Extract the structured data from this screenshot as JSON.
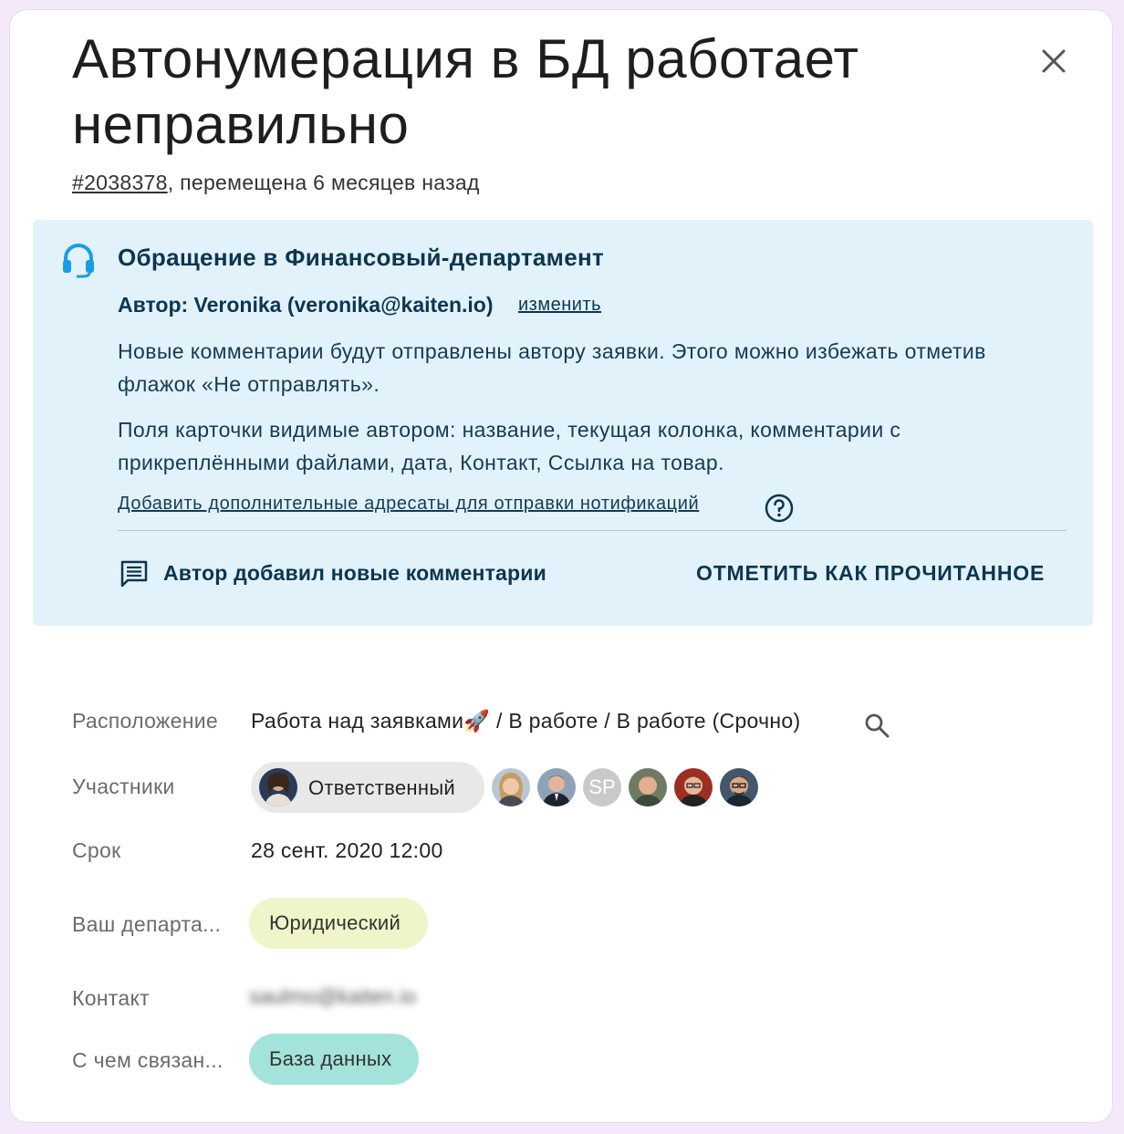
{
  "header": {
    "title": "Автонумерация в БД работает неправильно",
    "id_link": "#2038378",
    "moved_text": ", перемещена 6 месяцев назад",
    "close_icon": "close-icon"
  },
  "service_desk": {
    "icon": "headset-icon",
    "title": "Обращение в Финансовый-департамент",
    "author": "Автор: Veronika (veronika@kaiten.io)",
    "change_link": "изменить",
    "paragraph1": "Новые комментарии будут отправлены автору заявки. Этого можно избежать отметив флажок «Не отправлять».",
    "paragraph2": "Поля карточки видимые автором: название, текущая колонка, комментарии с прикреплёнными файлами, дата, Контакт, Ссылка на товар.",
    "add_recipients_link": "Добавить дополнительные адресаты для отправки нотификаций",
    "help_icon": "help-circle-icon",
    "comments_icon": "comment-icon",
    "comments_text": "Автор добавил новые комментарии",
    "mark_read_button": "ОТМЕТИТЬ КАК ПРОЧИТАННОЕ",
    "colors": {
      "background": "#e2f2fa",
      "text": "#0c3552"
    }
  },
  "properties": {
    "location": {
      "label": "Расположение",
      "value": "Работа над заявками🚀 / В работе / В работе (Срочно)"
    },
    "participants": {
      "label": "Участники",
      "responsible_label": "Ответственный",
      "members": [
        "avatar",
        "avatar",
        "SP",
        "avatar",
        "avatar",
        "avatar"
      ]
    },
    "due": {
      "label": "Срок",
      "value": "28 сент. 2020 12:00"
    },
    "department": {
      "label": "Ваш департа...",
      "value": "Юридический",
      "color": "#eff5c8"
    },
    "contact": {
      "label": "Контакт",
      "value": "saulmo@kaiten.io"
    },
    "related": {
      "label": "С чем связан...",
      "value": "База данных",
      "color": "#a3e3dc"
    }
  }
}
